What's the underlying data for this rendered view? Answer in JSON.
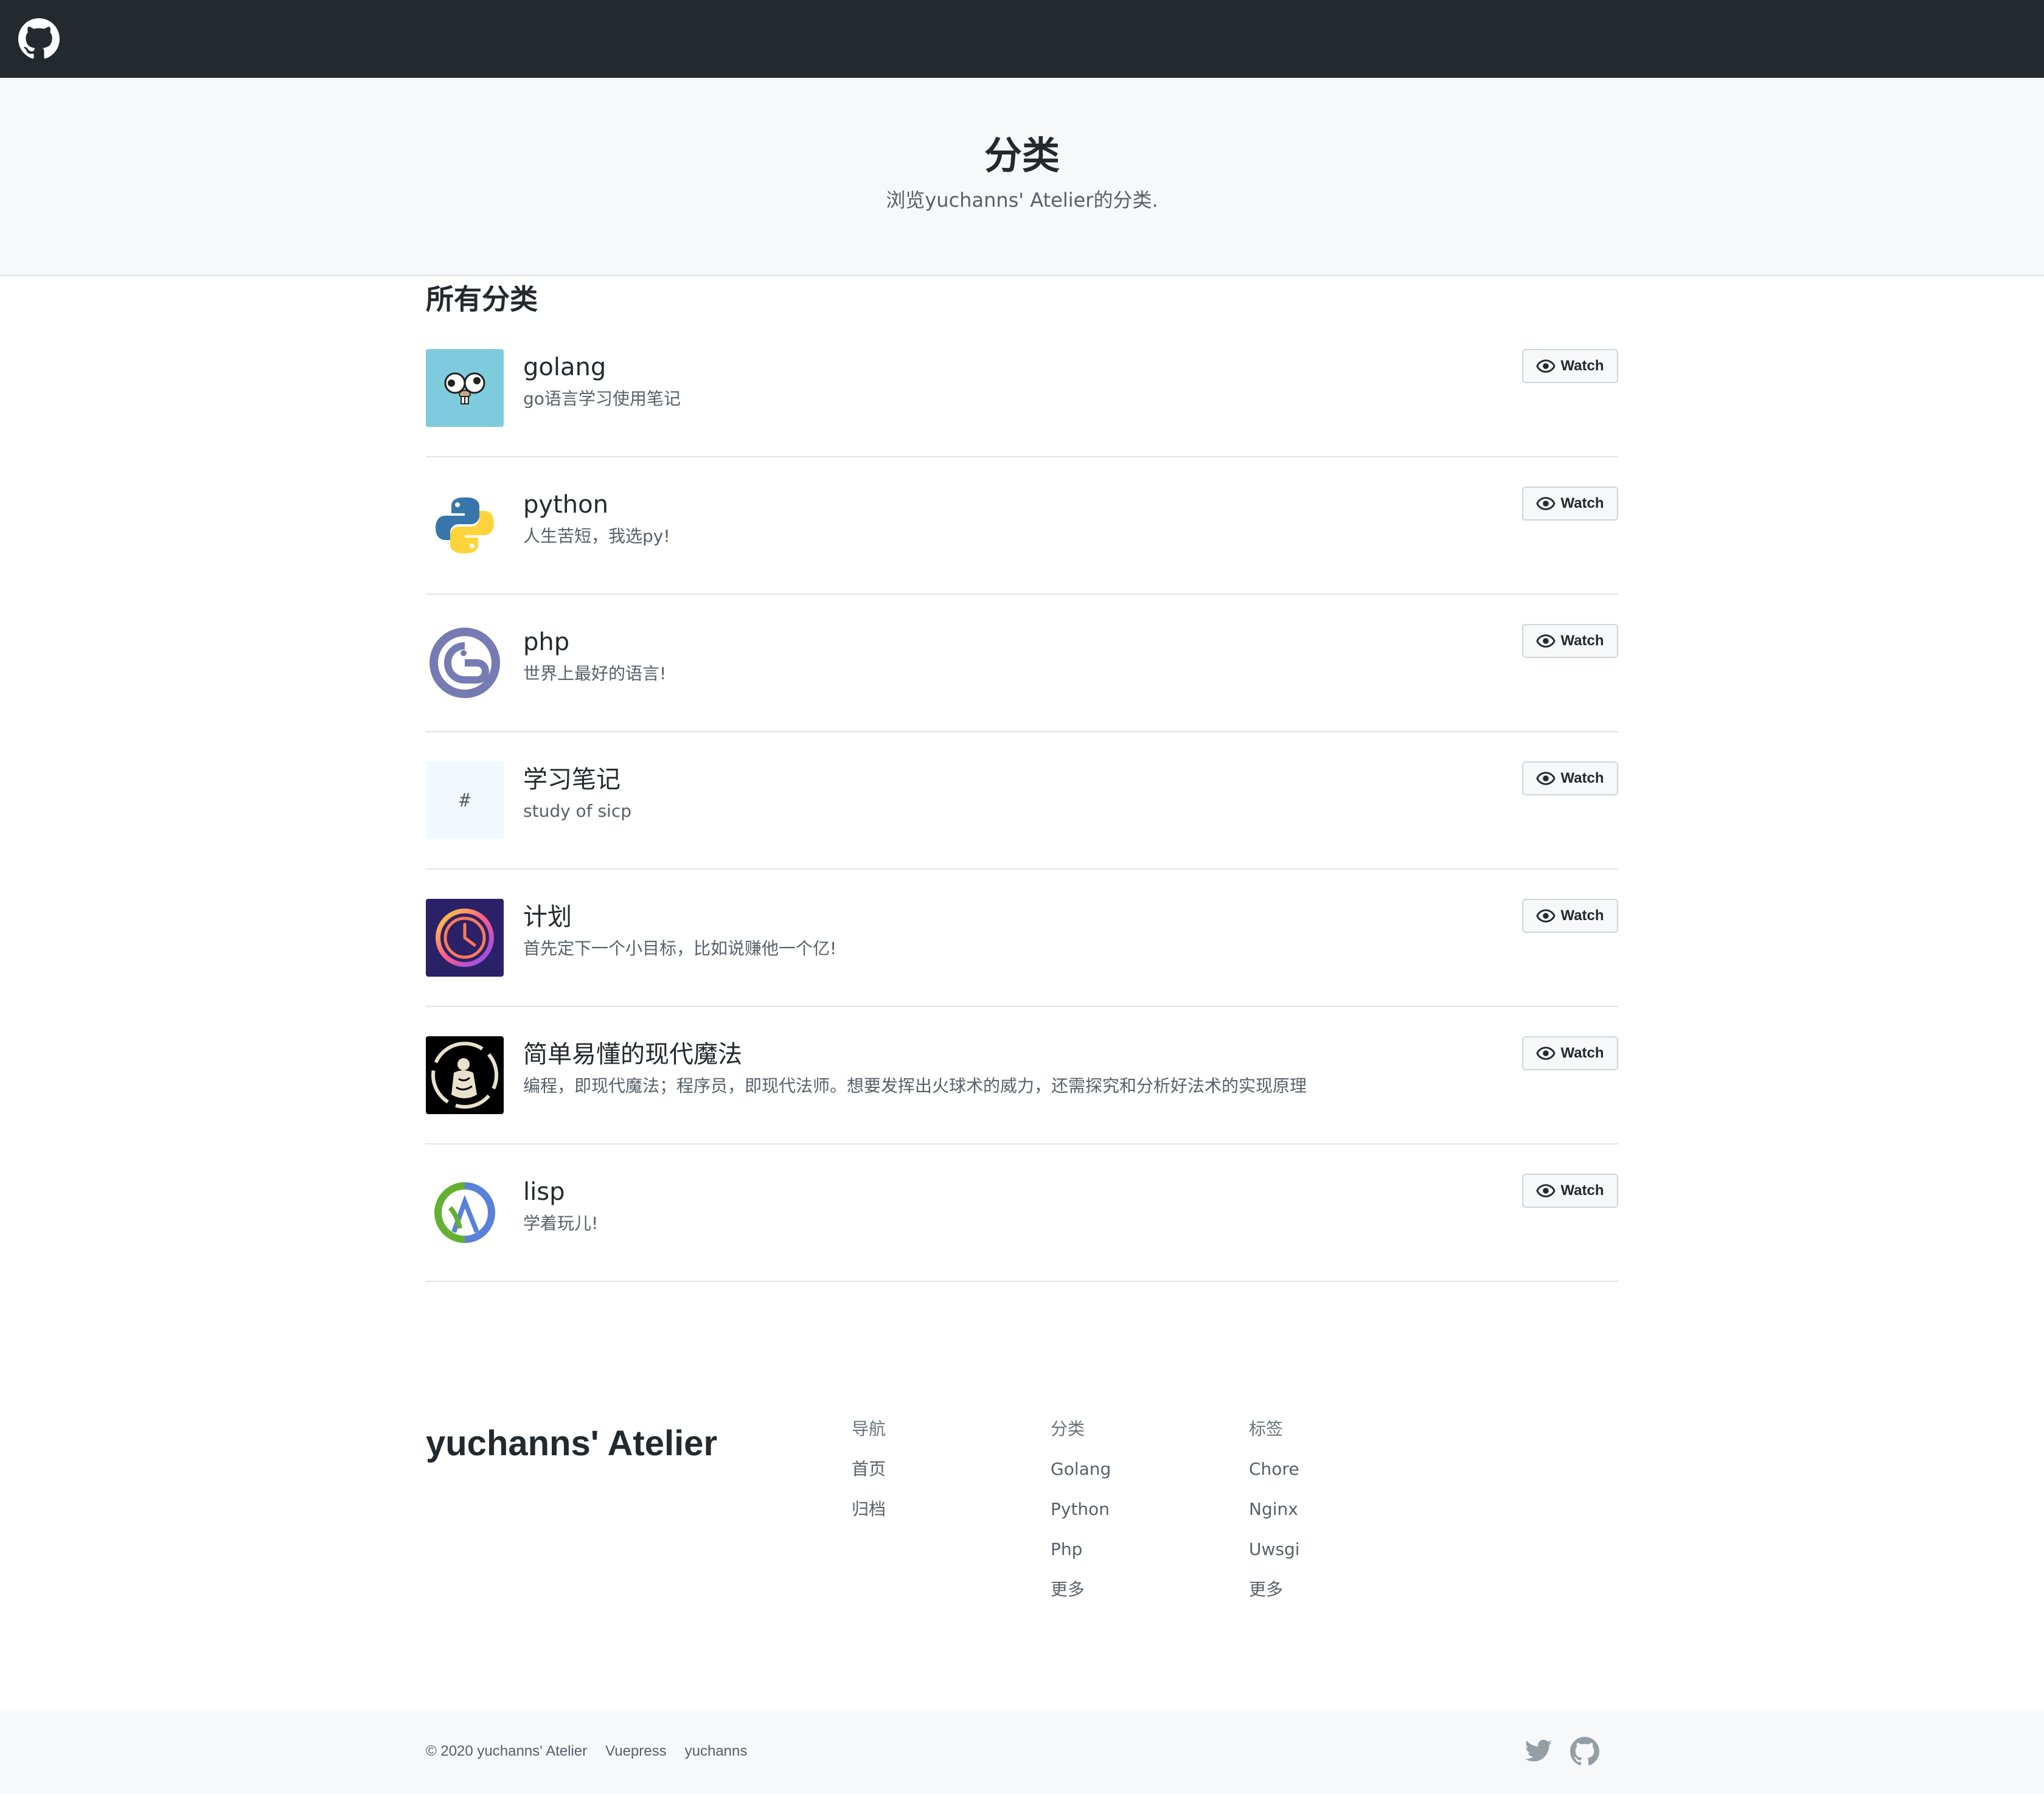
{
  "header": {
    "logo_icon": "github-icon"
  },
  "hero": {
    "title": "分类",
    "subtitle": "浏览yuchanns' Atelier的分类."
  },
  "section": {
    "title": "所有分类"
  },
  "categories": [
    {
      "name": "golang",
      "desc": "go语言学习使用笔记",
      "icon": "gopher-logo",
      "watch": "Watch"
    },
    {
      "name": "python",
      "desc": "人生苦短，我选py!",
      "icon": "python-logo",
      "watch": "Watch"
    },
    {
      "name": "php",
      "desc": "世界上最好的语言!",
      "icon": "php-logo",
      "watch": "Watch"
    },
    {
      "name": "学习笔记",
      "desc": "study of sicp",
      "icon": "hash-icon",
      "watch": "Watch",
      "thumb_text": "#"
    },
    {
      "name": "计划",
      "desc": "首先定下一个小目标，比如说赚他一个亿!",
      "icon": "clock-logo",
      "watch": "Watch"
    },
    {
      "name": "简单易懂的现代魔法",
      "desc": "编程，即现代魔法；程序员，即现代法师。想要发挥出火球术的威力，还需探究和分析好法术的实现原理",
      "icon": "magic-logo",
      "watch": "Watch"
    },
    {
      "name": "lisp",
      "desc": "学着玩儿!",
      "icon": "clojure-logo",
      "watch": "Watch"
    }
  ],
  "footer": {
    "brand": "yuchanns' Atelier",
    "nav": {
      "heading": "导航",
      "links": [
        "首页",
        "归档"
      ]
    },
    "categories": {
      "heading": "分类",
      "links": [
        "Golang",
        "Python",
        "Php",
        "更多"
      ]
    },
    "tags": {
      "heading": "标签",
      "links": [
        "Chore",
        "Nginx",
        "Uwsgi",
        "更多"
      ]
    }
  },
  "bottom": {
    "copyright": "© 2020 yuchanns' Atelier",
    "link1": "Vuepress",
    "link2": "yuchanns",
    "social_icons": [
      "twitter-icon",
      "github-icon"
    ]
  },
  "colors": {
    "topbar": "#24292e",
    "hero_bg": "#f6f8fa",
    "text": "#24292e",
    "muted": "#586069",
    "gopher_bg": "#7fcbde",
    "php_purple": "#777bb3",
    "clojure_green": "#63b132",
    "clojure_blue": "#5881d8"
  }
}
